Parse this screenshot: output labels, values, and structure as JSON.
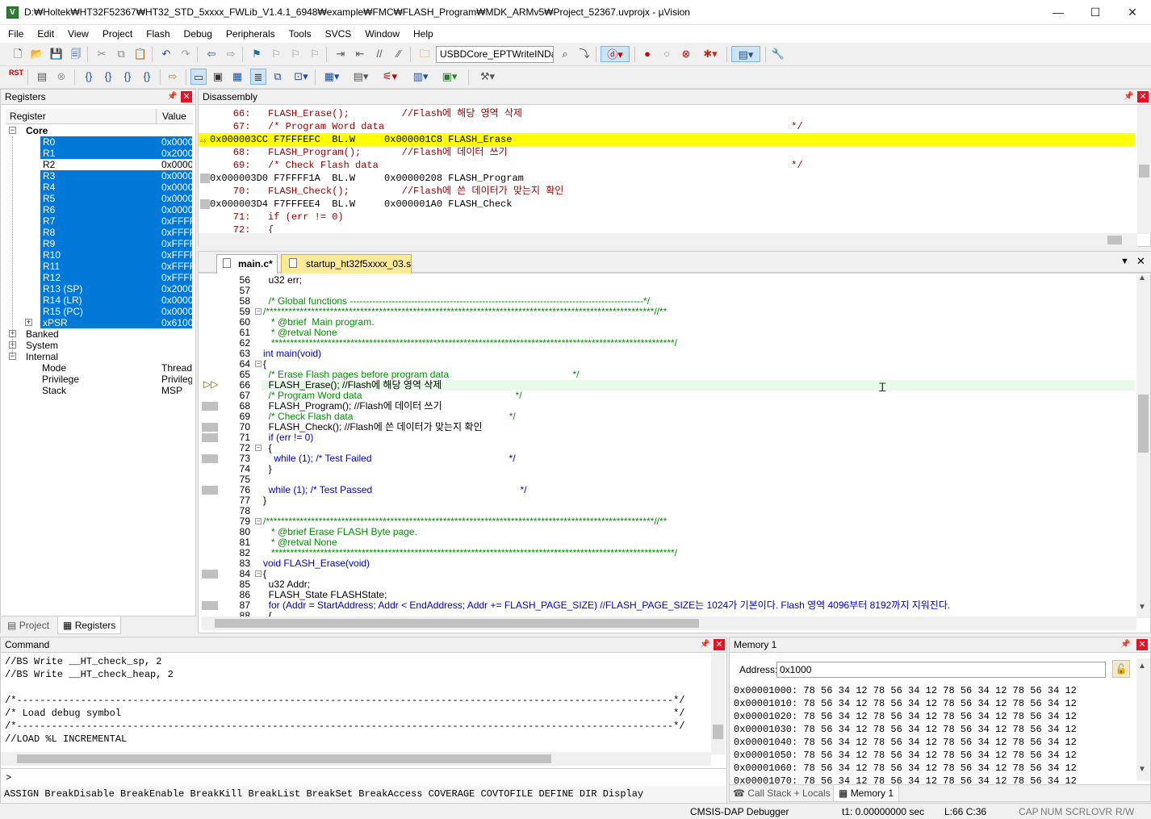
{
  "window": {
    "title": "D:₩Holtek₩HT32F52367₩HT32_STD_5xxxx_FWLib_V1.4.1_6948₩example₩FMC₩FLASH_Program₩MDK_ARMv5₩Project_52367.uvprojx - µVision",
    "app_icon": "V",
    "minimize": "—",
    "maximize": "☐",
    "close": "✕"
  },
  "menu": [
    "File",
    "Edit",
    "View",
    "Project",
    "Flash",
    "Debug",
    "Peripherals",
    "Tools",
    "SVCS",
    "Window",
    "Help"
  ],
  "toolbar1": {
    "target_select": "USBDCore_EPTWriteINDa",
    "icons": [
      "new-file-icon",
      "open-folder-icon",
      "save-icon",
      "save-all-icon",
      "cut-icon",
      "copy-icon",
      "paste-icon",
      "undo-icon",
      "redo-icon",
      "nav-back-icon",
      "nav-forward-icon",
      "bookmark-icon",
      "bookmark-prev-icon",
      "bookmark-next-icon",
      "bookmark-clear-icon",
      "indent-icon",
      "unindent-icon",
      "comment-icon",
      "uncomment-icon",
      "find-in-files-icon",
      "find-icon",
      "incremental-find-icon",
      "debug-session-icon",
      "breakpoint-icon",
      "breakpoint-disable-icon",
      "breakpoint-kill-icon",
      "breakpoint-list-icon",
      "window-select-icon",
      "configure-icon"
    ]
  },
  "toolbar2": {
    "rst_label": "RST",
    "icons": [
      "reset-icon",
      "run-icon",
      "stop-icon",
      "step-into-icon",
      "step-over-icon",
      "step-out-icon",
      "run-to-cursor-icon",
      "show-next-statement-icon",
      "command-window-icon",
      "disassembly-window-icon",
      "symbols-window-icon",
      "registers-window-icon",
      "call-stack-icon",
      "watch-window-icon",
      "memory-window-icon",
      "serial-window-icon",
      "analysis-window-icon",
      "trace-window-icon",
      "system-viewer-icon",
      "toolbox-icon"
    ]
  },
  "registers": {
    "title": "Registers",
    "col_register": "Register",
    "col_value": "Value",
    "groups": [
      {
        "name": "Core",
        "expanded": "−"
      },
      {
        "name": "Banked",
        "expanded": "+"
      },
      {
        "name": "System",
        "expanded": "+"
      },
      {
        "name": "Internal",
        "expanded": "−"
      }
    ],
    "core": [
      {
        "name": "R0",
        "value": "0x0000"
      },
      {
        "name": "R1",
        "value": "0x2000"
      },
      {
        "name": "R2",
        "value": "0x0000"
      },
      {
        "name": "R3",
        "value": "0x0000"
      },
      {
        "name": "R4",
        "value": "0x0000"
      },
      {
        "name": "R5",
        "value": "0x0000"
      },
      {
        "name": "R6",
        "value": "0x0000"
      },
      {
        "name": "R7",
        "value": "0xFFFF"
      },
      {
        "name": "R8",
        "value": "0xFFFF"
      },
      {
        "name": "R9",
        "value": "0xFFFF"
      },
      {
        "name": "R10",
        "value": "0xFFFF"
      },
      {
        "name": "R11",
        "value": "0xFFFF"
      },
      {
        "name": "R12",
        "value": "0xFFFF"
      },
      {
        "name": "R13 (SP)",
        "value": "0x2000"
      },
      {
        "name": "R14 (LR)",
        "value": "0x0000"
      },
      {
        "name": "R15 (PC)",
        "value": "0x0000"
      },
      {
        "name": "xPSR",
        "value": "0x6100"
      }
    ],
    "internal": [
      {
        "name": "Mode",
        "value": "Thread"
      },
      {
        "name": "Privilege",
        "value": "Privileged"
      },
      {
        "name": "Stack",
        "value": "MSP"
      }
    ],
    "tab_project": "Project",
    "tab_registers": "Registers"
  },
  "disassembly": {
    "title": "Disassembly",
    "lines": [
      "    66:   FLASH_Erase();         //Flash에 해당 영역 삭제",
      "    67:   /* Program Word data                                                                      */",
      "0x000003CC F7FFFEFC  BL.W     0x000001C8 FLASH_Erase",
      "    68:   FLASH_Program();       //Flash에 데이터 쓰기",
      "    69:   /* Check Flash data                                                                       */",
      "0x000003D0 F7FFFF1A  BL.W     0x00000208 FLASH_Program",
      "    70:   FLASH_Check();         //Flash에 쓴 데이터가 맞는지 확인",
      "0x000003D4 F7FFFEE4  BL.W     0x000001A0 FLASH_Check",
      "    71:   if (err != 0)",
      "    72:   {"
    ]
  },
  "editor": {
    "tabs": [
      "main.c*",
      "startup_ht32f5xxxx_03.s"
    ],
    "lines": [
      {
        "n": "56",
        "t": "  u32 err;"
      },
      {
        "n": "57",
        "t": ""
      },
      {
        "n": "58",
        "t": "  /* Global functions -------------------------------------------------------------------------------------------*/"
      },
      {
        "n": "59",
        "t": "/*******************************************************************************************************//**"
      },
      {
        "n": "60",
        "t": "   * @brief  Main program."
      },
      {
        "n": "61",
        "t": "   * @retval None"
      },
      {
        "n": "62",
        "t": "   ***********************************************************************************************************/"
      },
      {
        "n": "63",
        "t": "int main(void)"
      },
      {
        "n": "64",
        "t": "{"
      },
      {
        "n": "65",
        "t": "  /* Erase Flash pages before program data                                              */"
      },
      {
        "n": "66",
        "t": "  FLASH_Erase(); //Flash에 해당 영역 삭제"
      },
      {
        "n": "67",
        "t": "  /* Program Word data                                                         */"
      },
      {
        "n": "68",
        "t": "  FLASH_Program(); //Flash에 데이터 쓰기"
      },
      {
        "n": "69",
        "t": "  /* Check Flash data                                                          */"
      },
      {
        "n": "70",
        "t": "  FLASH_Check(); //Flash에 쓴 데이터가 맞는지 확인"
      },
      {
        "n": "71",
        "t": "  if (err != 0)"
      },
      {
        "n": "72",
        "t": "  {"
      },
      {
        "n": "73",
        "t": "    while (1); /* Test Failed                                                   */"
      },
      {
        "n": "74",
        "t": "  }"
      },
      {
        "n": "75",
        "t": ""
      },
      {
        "n": "76",
        "t": "  while (1); /* Test Passed                                                       */"
      },
      {
        "n": "77",
        "t": "}"
      },
      {
        "n": "78",
        "t": ""
      },
      {
        "n": "79",
        "t": "/*******************************************************************************************************//**"
      },
      {
        "n": "80",
        "t": "   * @brief Erase FLASH Byte page."
      },
      {
        "n": "81",
        "t": "   * @retval None"
      },
      {
        "n": "82",
        "t": "   ***********************************************************************************************************/"
      },
      {
        "n": "83",
        "t": "void FLASH_Erase(void)"
      },
      {
        "n": "84",
        "t": "{"
      },
      {
        "n": "85",
        "t": "  u32 Addr;"
      },
      {
        "n": "86",
        "t": "  FLASH_State FLASHState;"
      },
      {
        "n": "87",
        "t": "  for (Addr = StartAddress; Addr < EndAddress; Addr += FLASH_PAGE_SIZE) //FLASH_PAGE_SIZE는 1024가 기본이다. Flash 영역 4096부터 8192까지 지워진다."
      },
      {
        "n": "88",
        "t": "  {"
      }
    ]
  },
  "command": {
    "title": "Command",
    "lines": [
      "//BS Write __HT_check_sp, 2",
      "//BS Write __HT_check_heap, 2",
      "",
      "/*-----------------------------------------------------------------------------------------------------------------*/",
      "/* Load debug symbol                                                                                               */",
      "/*-----------------------------------------------------------------------------------------------------------------*/",
      "//LOAD %L INCREMENTAL"
    ],
    "prompt": ">",
    "hint": "ASSIGN BreakDisable BreakEnable BreakKill BreakList BreakSet BreakAccess COVERAGE COVTOFILE DEFINE DIR Display"
  },
  "memory": {
    "title": "Memory 1",
    "address_label": "Address:",
    "address_value": "0x1000",
    "rows": [
      "0x00001000: 78 56 34 12 78 56 34 12 78 56 34 12 78 56 34 12",
      "0x00001010: 78 56 34 12 78 56 34 12 78 56 34 12 78 56 34 12",
      "0x00001020: 78 56 34 12 78 56 34 12 78 56 34 12 78 56 34 12",
      "0x00001030: 78 56 34 12 78 56 34 12 78 56 34 12 78 56 34 12",
      "0x00001040: 78 56 34 12 78 56 34 12 78 56 34 12 78 56 34 12",
      "0x00001050: 78 56 34 12 78 56 34 12 78 56 34 12 78 56 34 12",
      "0x00001060: 78 56 34 12 78 56 34 12 78 56 34 12 78 56 34 12",
      "0x00001070: 78 56 34 12 78 56 34 12 78 56 34 12 78 56 34 12"
    ],
    "tab_callstack": "Call Stack + Locals",
    "tab_memory": "Memory 1"
  },
  "status": {
    "debugger": "CMSIS-DAP Debugger",
    "time": "t1: 0.00000000 sec",
    "cursor": "L:66 C:36",
    "cap": "CAP",
    "num": "NUM",
    "scrl": "SCRL",
    "ovr": "OVR",
    "rw": "R/W"
  },
  "colors": {
    "selection": "#0078d7",
    "current_line": "#ffff00",
    "comment": "#009000",
    "keyword": "#0000ff",
    "close_red": "#e81123"
  }
}
